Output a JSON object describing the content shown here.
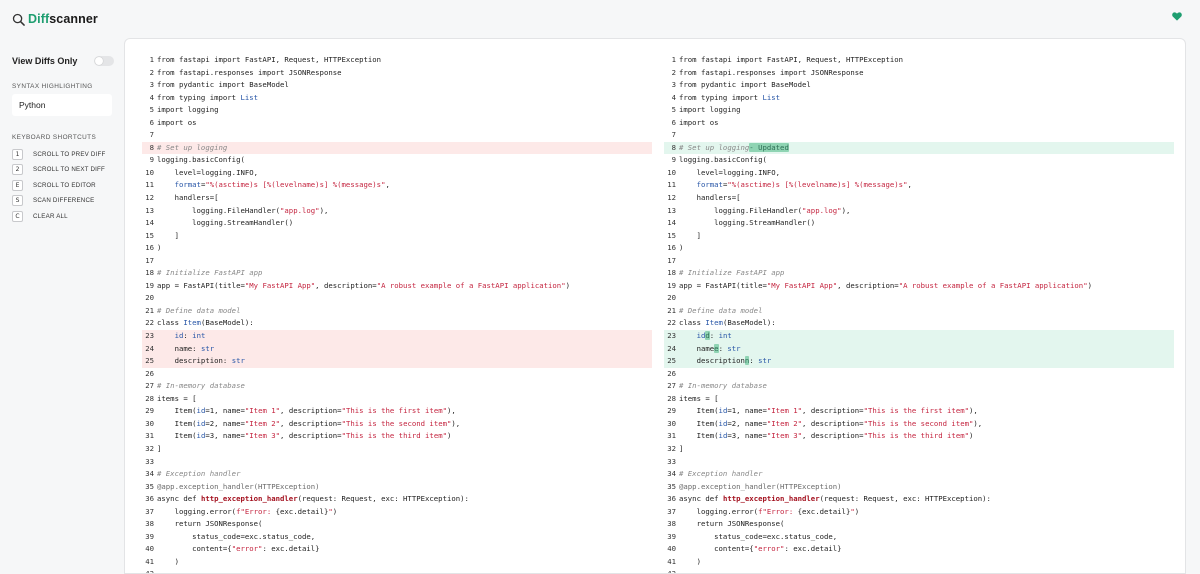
{
  "app": {
    "logo_diff": "Diff",
    "logo_scanner": "scanner"
  },
  "sidebar": {
    "view_diffs_only": "View Diffs Only",
    "syntax_highlighting_label": "SYNTAX HIGHLIGHTING",
    "language": "Python",
    "shortcuts_label": "KEYBOARD SHORTCUTS",
    "shortcuts": [
      {
        "key": "1",
        "label": "SCROLL TO PREV DIFF"
      },
      {
        "key": "2",
        "label": "SCROLL TO NEXT DIFF"
      },
      {
        "key": "E",
        "label": "SCROLL TO EDITOR"
      },
      {
        "key": "S",
        "label": "SCAN DIFFERENCE"
      },
      {
        "key": "C",
        "label": "CLEAR ALL"
      }
    ]
  },
  "colors": {
    "accent": "#1e9e70",
    "deleted_bg": "#fde9e8",
    "added_bg": "#e3f6ee"
  },
  "left_lines": [
    {
      "n": "1",
      "t": "[[from fastapi import FastAPI, Request, HTTPException]]"
    },
    {
      "n": "2",
      "t": "[[from fastapi.responses import JSONResponse]]"
    },
    {
      "n": "3",
      "t": "[[from pydantic import BaseModel]]"
    },
    {
      "n": "4",
      "t": "[[from typing import ]]{k|List}"
    },
    {
      "n": "5",
      "t": "[[import logging]]"
    },
    {
      "n": "6",
      "t": "[[import os]]"
    },
    {
      "n": "7",
      "t": ""
    },
    {
      "n": "8",
      "t": "{c|# Set up logging}",
      "type": "del"
    },
    {
      "n": "9",
      "t": "[[logging.basicConfig(]]"
    },
    {
      "n": "10",
      "t": "[[    level=logging.INFO,]]"
    },
    {
      "n": "11",
      "t": "    {k|format}[[=]]{s|\"%(asctime)s [%(levelname)s] %(message)s\"}[[,]]"
    },
    {
      "n": "12",
      "t": "[[    handlers=[]]"
    },
    {
      "n": "13",
      "t": "[[        logging.FileHandler(]]{s|\"app.log\"}[[),]]"
    },
    {
      "n": "14",
      "t": "[[        logging.StreamHandler()]]"
    },
    {
      "n": "15",
      "t": "[[    ]]]"
    },
    {
      "n": "16",
      "t": "[[)]]"
    },
    {
      "n": "17",
      "t": ""
    },
    {
      "n": "18",
      "t": "{c|# Initialize FastAPI app}"
    },
    {
      "n": "19",
      "t": "[[app = FastAPI(title=]]{s|\"My FastAPI App\"}[[, description=]]{s|\"A robust example of a FastAPI application\"}[[)]]"
    },
    {
      "n": "20",
      "t": ""
    },
    {
      "n": "21",
      "t": "{c|# Define data model}"
    },
    {
      "n": "22",
      "t": "[[class ]]{k|Item}[[(BaseModel):]]"
    },
    {
      "n": "23",
      "t": "    {k|id}[[: ]]{k|int}",
      "type": "del"
    },
    {
      "n": "24",
      "t": "[[    name: ]]{k|str}",
      "type": "del"
    },
    {
      "n": "25",
      "t": "[[    description: ]]{k|str}",
      "type": "del"
    },
    {
      "n": "26",
      "t": ""
    },
    {
      "n": "27",
      "t": "{c|# In-memory database}"
    },
    {
      "n": "28",
      "t": "[[items = []]"
    },
    {
      "n": "29",
      "t": "[[    Item(]]{k|id}[[=1, name=]]{s|\"Item 1\"}[[, description=]]{s|\"This is the first item\"}[[),]]"
    },
    {
      "n": "30",
      "t": "[[    Item(]]{k|id}[[=2, name=]]{s|\"Item 2\"}[[, description=]]{s|\"This is the second item\"}[[),]]"
    },
    {
      "n": "31",
      "t": "[[    Item(]]{k|id}[[=3, name=]]{s|\"Item 3\"}[[, description=]]{s|\"This is the third item\"}[[)]]"
    },
    {
      "n": "32",
      "t": "[[]]]"
    },
    {
      "n": "33",
      "t": ""
    },
    {
      "n": "34",
      "t": "{c|# Exception handler}"
    },
    {
      "n": "35",
      "t": "{d|@app.exception_handler(HTTPException)}"
    },
    {
      "n": "36",
      "t": "[[async def ]]{f|http_exception_handler}[[(request: Request, exc: HTTPException):]]"
    },
    {
      "n": "37",
      "t": "[[    logging.error(]]{s|f\"Error: }[[{exc.detail}]]{s|\"}[[)]]"
    },
    {
      "n": "38",
      "t": "[[    return JSONResponse(]]"
    },
    {
      "n": "39",
      "t": "[[        status_code=exc.status_code,]]"
    },
    {
      "n": "40",
      "t": "[[        content={]]{s|\"error\"}[[: exc.detail}]]"
    },
    {
      "n": "41",
      "t": "[[    )]]"
    },
    {
      "n": "42",
      "t": ""
    }
  ],
  "right_lines": [
    {
      "n": "1",
      "t": "[[from fastapi import FastAPI, Request, HTTPException]]"
    },
    {
      "n": "2",
      "t": "[[from fastapi.responses import JSONResponse]]"
    },
    {
      "n": "3",
      "t": "[[from pydantic import BaseModel]]"
    },
    {
      "n": "4",
      "t": "[[from typing import ]]{k|List}"
    },
    {
      "n": "5",
      "t": "[[import logging]]"
    },
    {
      "n": "6",
      "t": "[[import os]]"
    },
    {
      "n": "7",
      "t": ""
    },
    {
      "n": "8",
      "t": "{c|# Set up logging}{h|- Updated}",
      "type": "add"
    },
    {
      "n": "9",
      "t": "[[logging.basicConfig(]]"
    },
    {
      "n": "10",
      "t": "[[    level=logging.INFO,]]"
    },
    {
      "n": "11",
      "t": "    {k|format}[[=]]{s|\"%(asctime)s [%(levelname)s] %(message)s\"}[[,]]"
    },
    {
      "n": "12",
      "t": "[[    handlers=[]]"
    },
    {
      "n": "13",
      "t": "[[        logging.FileHandler(]]{s|\"app.log\"}[[),]]"
    },
    {
      "n": "14",
      "t": "[[        logging.StreamHandler()]]"
    },
    {
      "n": "15",
      "t": "[[    ]]]"
    },
    {
      "n": "16",
      "t": "[[)]]"
    },
    {
      "n": "17",
      "t": ""
    },
    {
      "n": "18",
      "t": "{c|# Initialize FastAPI app}"
    },
    {
      "n": "19",
      "t": "[[app = FastAPI(title=]]{s|\"My FastAPI App\"}[[, description=]]{s|\"A robust example of a FastAPI application\"}[[)]]"
    },
    {
      "n": "20",
      "t": ""
    },
    {
      "n": "21",
      "t": "{c|# Define data model}"
    },
    {
      "n": "22",
      "t": "[[class ]]{k|Item}[[(BaseModel):]]"
    },
    {
      "n": "23",
      "t": "    {k|id}{h|d}[[: ]]{k|int}",
      "type": "add"
    },
    {
      "n": "24",
      "t": "[[    name]]{h|e}[[: ]]{k|str}",
      "type": "add"
    },
    {
      "n": "25",
      "t": "[[    description]]{h|n}[[: ]]{k|str}",
      "type": "add"
    },
    {
      "n": "26",
      "t": ""
    },
    {
      "n": "27",
      "t": "{c|# In-memory database}"
    },
    {
      "n": "28",
      "t": "[[items = []]"
    },
    {
      "n": "29",
      "t": "[[    Item(]]{k|id}[[=1, name=]]{s|\"Item 1\"}[[, description=]]{s|\"This is the first item\"}[[),]]"
    },
    {
      "n": "30",
      "t": "[[    Item(]]{k|id}[[=2, name=]]{s|\"Item 2\"}[[, description=]]{s|\"This is the second item\"}[[),]]"
    },
    {
      "n": "31",
      "t": "[[    Item(]]{k|id}[[=3, name=]]{s|\"Item 3\"}[[, description=]]{s|\"This is the third item\"}[[)]]"
    },
    {
      "n": "32",
      "t": "[[]]]"
    },
    {
      "n": "33",
      "t": ""
    },
    {
      "n": "34",
      "t": "{c|# Exception handler}"
    },
    {
      "n": "35",
      "t": "{d|@app.exception_handler(HTTPException)}"
    },
    {
      "n": "36",
      "t": "[[async def ]]{f|http_exception_handler}[[(request: Request, exc: HTTPException):]]"
    },
    {
      "n": "37",
      "t": "[[    logging.error(]]{s|f\"Error: }[[{exc.detail}]]{s|\"}[[)]]"
    },
    {
      "n": "38",
      "t": "[[    return JSONResponse(]]"
    },
    {
      "n": "39",
      "t": "[[        status_code=exc.status_code,]]"
    },
    {
      "n": "40",
      "t": "[[        content={]]{s|\"error\"}[[: exc.detail}]]"
    },
    {
      "n": "41",
      "t": "[[    )]]"
    },
    {
      "n": "42",
      "t": ""
    }
  ]
}
